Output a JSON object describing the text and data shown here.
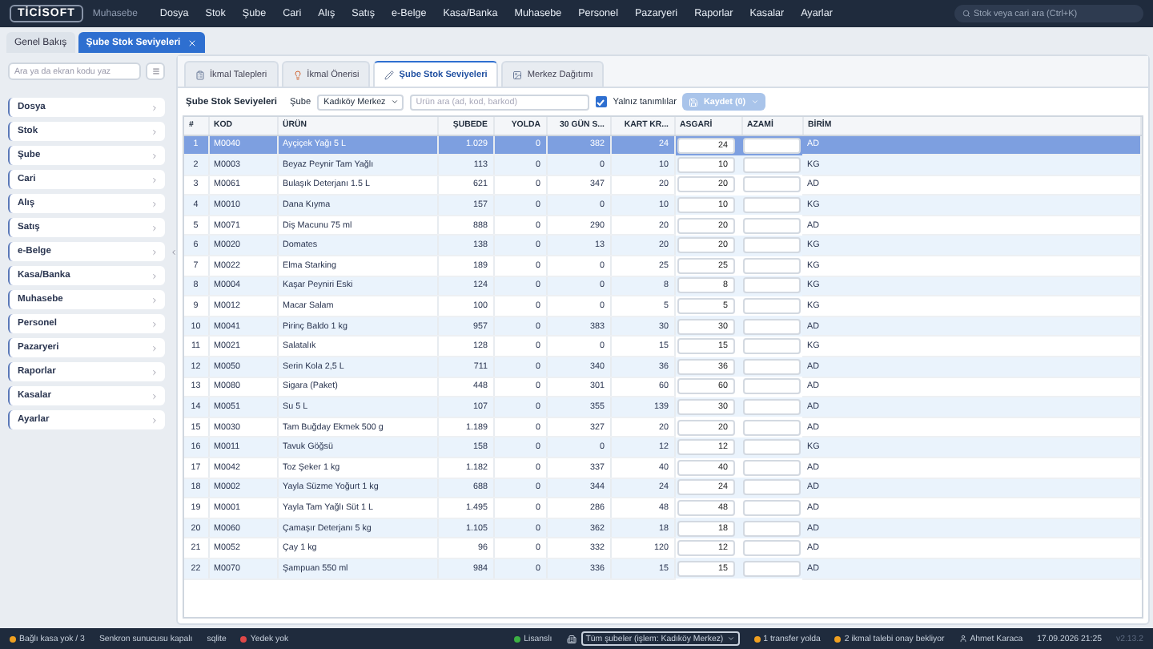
{
  "app": {
    "logo": "TİCİSOFT",
    "module": "Muhasebe"
  },
  "menu": [
    "Dosya",
    "Stok",
    "Şube",
    "Cari",
    "Alış",
    "Satış",
    "e-Belge",
    "Kasa/Banka",
    "Muhasebe",
    "Personel",
    "Pazaryeri",
    "Raporlar",
    "Kasalar",
    "Ayarlar"
  ],
  "global_search": {
    "placeholder": "Stok veya cari ara (Ctrl+K)"
  },
  "tabs": [
    {
      "label": "Genel Bakış",
      "selected": false,
      "closable": false
    },
    {
      "label": "Şube Stok Seviyeleri",
      "selected": true,
      "closable": true
    }
  ],
  "sidebar": {
    "search_placeholder": "Ara ya da ekran kodu yaz",
    "items": [
      "Dosya",
      "Stok",
      "Şube",
      "Cari",
      "Alış",
      "Satış",
      "e-Belge",
      "Kasa/Banka",
      "Muhasebe",
      "Personel",
      "Pazaryeri",
      "Raporlar",
      "Kasalar",
      "Ayarlar"
    ]
  },
  "subtabs": [
    {
      "label": "İkmal Talepleri",
      "selected": false
    },
    {
      "label": "İkmal Önerisi",
      "selected": false
    },
    {
      "label": "Şube Stok Seviyeleri",
      "selected": true
    },
    {
      "label": "Merkez Dağıtımı",
      "selected": false
    }
  ],
  "toolbar": {
    "title": "Şube Stok Seviyeleri",
    "branch_label": "Şube",
    "branch": "Kadıköy Merkez",
    "search_placeholder": "Ürün ara (ad, kod, barkod)",
    "only_defined": {
      "label": "Yalnız tanımlılar",
      "checked": true
    },
    "save": {
      "label": "Kaydet (0)",
      "disabled": true
    }
  },
  "table": {
    "columns": [
      "#",
      "KOD",
      "ÜRÜN",
      "ŞUBEDE",
      "YOLDA",
      "30 GÜN S...",
      "KART KR...",
      "ASGARİ",
      "AZAMİ",
      "BİRİM"
    ],
    "rows": [
      {
        "no": "1",
        "code": "M0040",
        "product": "Ayçiçek Yağı 5 L",
        "branch_qty": "1.029",
        "in_transit": "0",
        "sales_30d": "382",
        "card_min": "24",
        "min": "24",
        "unit": "AD",
        "selected": true
      },
      {
        "no": "2",
        "code": "M0003",
        "product": "Beyaz Peynir Tam Yağlı",
        "branch_qty": "113",
        "in_transit": "0",
        "sales_30d": "0",
        "card_min": "10",
        "min": "10",
        "unit": "KG",
        "selected": false
      },
      {
        "no": "3",
        "code": "M0061",
        "product": "Bulaşık Deterjanı 1.5 L",
        "branch_qty": "621",
        "in_transit": "0",
        "sales_30d": "347",
        "card_min": "20",
        "min": "20",
        "unit": "AD",
        "selected": false
      },
      {
        "no": "4",
        "code": "M0010",
        "product": "Dana Kıyma",
        "branch_qty": "157",
        "in_transit": "0",
        "sales_30d": "0",
        "card_min": "10",
        "min": "10",
        "unit": "KG",
        "selected": false
      },
      {
        "no": "5",
        "code": "M0071",
        "product": "Diş Macunu 75 ml",
        "branch_qty": "888",
        "in_transit": "0",
        "sales_30d": "290",
        "card_min": "20",
        "min": "20",
        "unit": "AD",
        "selected": false
      },
      {
        "no": "6",
        "code": "M0020",
        "product": "Domates",
        "branch_qty": "138",
        "in_transit": "0",
        "sales_30d": "13",
        "card_min": "20",
        "min": "20",
        "unit": "KG",
        "selected": false
      },
      {
        "no": "7",
        "code": "M0022",
        "product": "Elma Starking",
        "branch_qty": "189",
        "in_transit": "0",
        "sales_30d": "0",
        "card_min": "25",
        "min": "25",
        "unit": "KG",
        "selected": false
      },
      {
        "no": "8",
        "code": "M0004",
        "product": "Kaşar Peyniri Eski",
        "branch_qty": "124",
        "in_transit": "0",
        "sales_30d": "0",
        "card_min": "8",
        "min": "8",
        "unit": "KG",
        "selected": false
      },
      {
        "no": "9",
        "code": "M0012",
        "product": "Macar Salam",
        "branch_qty": "100",
        "in_transit": "0",
        "sales_30d": "0",
        "card_min": "5",
        "min": "5",
        "unit": "KG",
        "selected": false
      },
      {
        "no": "10",
        "code": "M0041",
        "product": "Pirinç Baldo 1 kg",
        "branch_qty": "957",
        "in_transit": "0",
        "sales_30d": "383",
        "card_min": "30",
        "min": "30",
        "unit": "AD",
        "selected": false
      },
      {
        "no": "11",
        "code": "M0021",
        "product": "Salatalık",
        "branch_qty": "128",
        "in_transit": "0",
        "sales_30d": "0",
        "card_min": "15",
        "min": "15",
        "unit": "KG",
        "selected": false
      },
      {
        "no": "12",
        "code": "M0050",
        "product": "Serin Kola 2,5 L",
        "branch_qty": "711",
        "in_transit": "0",
        "sales_30d": "340",
        "card_min": "36",
        "min": "36",
        "unit": "AD",
        "selected": false
      },
      {
        "no": "13",
        "code": "M0080",
        "product": "Sigara (Paket)",
        "branch_qty": "448",
        "in_transit": "0",
        "sales_30d": "301",
        "card_min": "60",
        "min": "60",
        "unit": "AD",
        "selected": false
      },
      {
        "no": "14",
        "code": "M0051",
        "product": "Su 5 L",
        "branch_qty": "107",
        "in_transit": "0",
        "sales_30d": "355",
        "card_min": "139",
        "min": "30",
        "unit": "AD",
        "selected": false
      },
      {
        "no": "15",
        "code": "M0030",
        "product": "Tam Buğday Ekmek 500 g",
        "branch_qty": "1.189",
        "in_transit": "0",
        "sales_30d": "327",
        "card_min": "20",
        "min": "20",
        "unit": "AD",
        "selected": false
      },
      {
        "no": "16",
        "code": "M0011",
        "product": "Tavuk Göğsü",
        "branch_qty": "158",
        "in_transit": "0",
        "sales_30d": "0",
        "card_min": "12",
        "min": "12",
        "unit": "KG",
        "selected": false
      },
      {
        "no": "17",
        "code": "M0042",
        "product": "Toz Şeker 1 kg",
        "branch_qty": "1.182",
        "in_transit": "0",
        "sales_30d": "337",
        "card_min": "40",
        "min": "40",
        "unit": "AD",
        "selected": false
      },
      {
        "no": "18",
        "code": "M0002",
        "product": "Yayla Süzme Yoğurt 1 kg",
        "branch_qty": "688",
        "in_transit": "0",
        "sales_30d": "344",
        "card_min": "24",
        "min": "24",
        "unit": "AD",
        "selected": false
      },
      {
        "no": "19",
        "code": "M0001",
        "product": "Yayla Tam Yağlı Süt 1 L",
        "branch_qty": "1.495",
        "in_transit": "0",
        "sales_30d": "286",
        "card_min": "48",
        "min": "48",
        "unit": "AD",
        "selected": false
      },
      {
        "no": "20",
        "code": "M0060",
        "product": "Çamaşır Deterjanı 5 kg",
        "branch_qty": "1.105",
        "in_transit": "0",
        "sales_30d": "362",
        "card_min": "18",
        "min": "18",
        "unit": "AD",
        "selected": false
      },
      {
        "no": "21",
        "code": "M0052",
        "product": "Çay 1 kg",
        "branch_qty": "96",
        "in_transit": "0",
        "sales_30d": "332",
        "card_min": "120",
        "min": "12",
        "unit": "AD",
        "selected": false
      },
      {
        "no": "22",
        "code": "M0070",
        "product": "Şampuan 550 ml",
        "branch_qty": "984",
        "in_transit": "0",
        "sales_30d": "336",
        "card_min": "15",
        "min": "15",
        "unit": "AD",
        "selected": false
      }
    ]
  },
  "status_bar": {
    "left": [
      {
        "kind": "dot",
        "text": "Bağlı kasa yok / 3",
        "color": "#f0a020"
      },
      {
        "kind": "plain",
        "text": "Senkron sunucusu kapalı"
      },
      {
        "kind": "plain",
        "text": "sqlite"
      },
      {
        "kind": "dot",
        "text": "Yedek yok",
        "color": "#e04848"
      }
    ],
    "right": [
      {
        "kind": "dot",
        "text": "Lisanslı",
        "color": "#3cb043"
      },
      {
        "kind": "select",
        "text": "Tüm şubeler (işlem: Kadıköy Merkez)"
      },
      {
        "kind": "dot",
        "text": "1 transfer yolda",
        "color": "#f0a020"
      },
      {
        "kind": "dot",
        "text": "2 ikmal talebi onay bekliyor",
        "color": "#f0a020"
      },
      {
        "kind": "user",
        "text": "Ahmet Karaca"
      },
      {
        "kind": "plain",
        "text": "17.09.2026 21:25"
      },
      {
        "kind": "faint",
        "text": "v2.13.2"
      }
    ]
  }
}
